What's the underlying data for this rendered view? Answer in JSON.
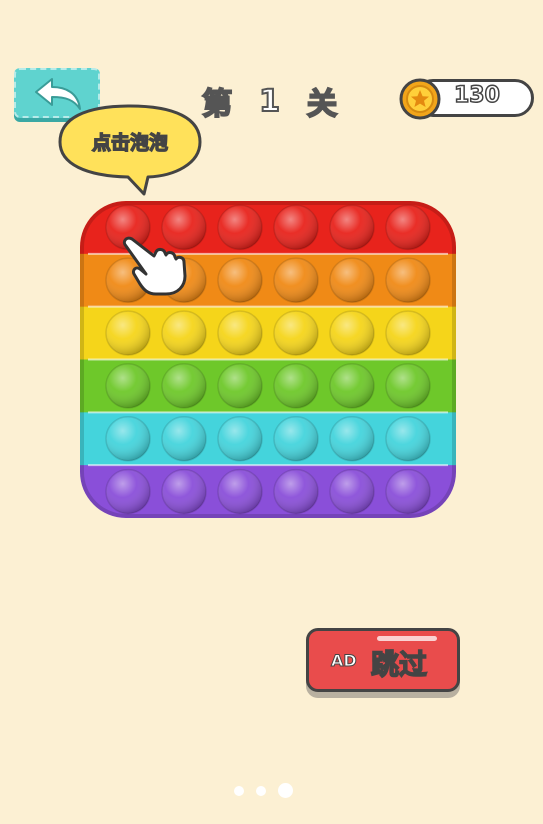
{
  "header": {
    "level_prefix": "第",
    "level_number": "1",
    "level_suffix": "关",
    "coins": "130"
  },
  "tip_bubble": {
    "text": "点击泡泡"
  },
  "popit": {
    "rows": 6,
    "cols": 6,
    "row_colors": [
      "#e8231c",
      "#f08a16",
      "#f5d51a",
      "#6ec82a",
      "#44d4dc",
      "#8a4fd9"
    ]
  },
  "skip_button": {
    "ad_label": "AD",
    "label": "跳过"
  },
  "pager": {
    "count": 3,
    "active_index": 2
  }
}
